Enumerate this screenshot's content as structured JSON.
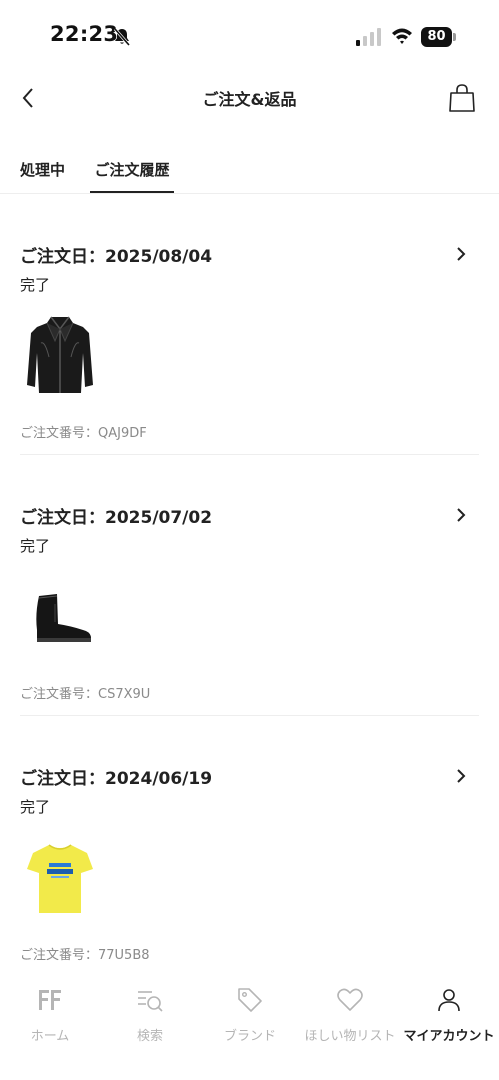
{
  "status_bar": {
    "time": "22:23",
    "battery": "80"
  },
  "header": {
    "title": "ご注文&返品"
  },
  "tabs": [
    {
      "label": "処理中",
      "active": false
    },
    {
      "label": "ご注文履歴",
      "active": true
    }
  ],
  "orders": [
    {
      "date": "ご注文日：2025/08/04",
      "status": "完了",
      "number": "ご注文番号：QAJ9DF",
      "product_icon": "leather-jacket-icon"
    },
    {
      "date": "ご注文日：2025/07/02",
      "status": "完了",
      "number": "ご注文番号：CS7X9U",
      "product_icon": "leather-boot-icon"
    },
    {
      "date": "ご注文日：2024/06/19",
      "status": "完了",
      "number": "ご注文番号：77U5B8",
      "product_icon": "yellow-tshirt-icon"
    }
  ],
  "bottom_nav": [
    {
      "label": "ホーム",
      "icon": "farfetch-logo-icon"
    },
    {
      "label": "検索",
      "icon": "search-list-icon"
    },
    {
      "label": "ブランド",
      "icon": "tag-icon"
    },
    {
      "label": "ほしい物リスト",
      "icon": "heart-icon"
    },
    {
      "label": "マイアカウント",
      "icon": "user-icon",
      "active": true
    }
  ],
  "colors": {
    "text_primary": "#222222",
    "text_secondary": "#8a8a8a",
    "nav_inactive": "#b5b5b5",
    "tshirt_yellow": "#f2ea4a"
  }
}
